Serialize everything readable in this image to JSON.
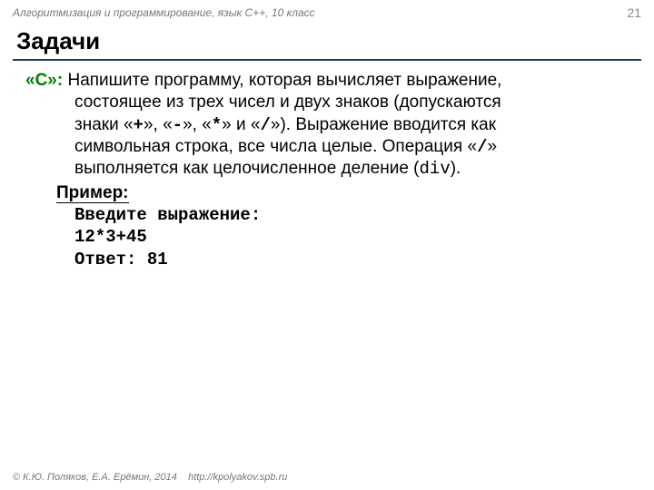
{
  "header": {
    "breadcrumb": "Алгоритмизация и программирование, язык C++, 10 класс",
    "page_number": "21"
  },
  "title": "Задачи",
  "task": {
    "level_label": "«C»:",
    "text_start": " Напишите программу, которая вычисляет выражение,",
    "body_line1": "состоящее из трех чисел и двух знаков (допускаются",
    "body_line2_pre": "знаки «",
    "op_plus": "+",
    "body_line2_mid1": "», «",
    "op_minus": "-",
    "body_line2_mid2": "», «",
    "op_mul": "*",
    "body_line2_mid3": "» и «",
    "op_div": "/",
    "body_line2_post": "»). Выражение вводится как",
    "body_line3_pre": "символьная строка, все числа целые. Операция «",
    "op_div2": "/",
    "body_line3_post": "»",
    "body_line4_pre": "выполняется как целочисленное деление (",
    "div_word": "div",
    "body_line4_post": ").",
    "example_label": "Пример:",
    "example_prompt": "Введите выражение:",
    "example_input": "12*3+45",
    "example_output": "Ответ: 81"
  },
  "footer": {
    "copyright": "© К.Ю. Поляков, Е.А. Ерёмин, 2014",
    "url": "http://kpolyakov.spb.ru"
  }
}
